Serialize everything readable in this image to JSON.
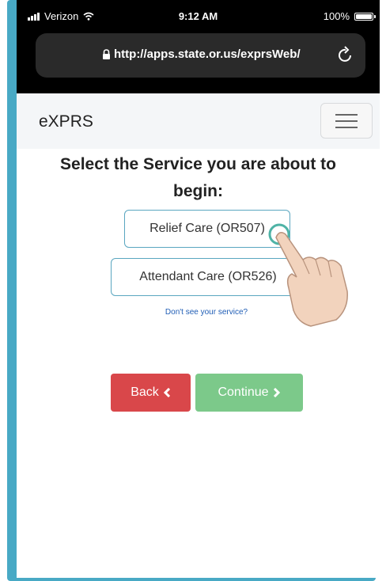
{
  "status_bar": {
    "carrier": "Verizon",
    "time": "9:12 AM",
    "battery": "100%"
  },
  "browser": {
    "url": "http://apps.state.or.us/exprsWeb/"
  },
  "navbar": {
    "brand": "eXPRS"
  },
  "main": {
    "heading_line1": "Select the Service you are about to",
    "heading_line2": "begin:",
    "services": [
      {
        "label": "Relief Care (OR507)"
      },
      {
        "label": "Attendant Care (OR526)"
      }
    ],
    "help_link": "Don't see your service?",
    "back_label": "Back",
    "continue_label": "Continue"
  },
  "colors": {
    "frame": "#48a9c5",
    "back_button": "#d9474a",
    "continue_button": "#7cc98a",
    "service_border": "#5aa6c0",
    "link": "#1f5db5"
  },
  "icons": [
    "signal-icon",
    "wifi-icon",
    "battery-icon",
    "lock-icon",
    "reload-icon",
    "menu-icon",
    "chevron-left-icon",
    "chevron-right-icon",
    "pointing-hand-icon"
  ]
}
